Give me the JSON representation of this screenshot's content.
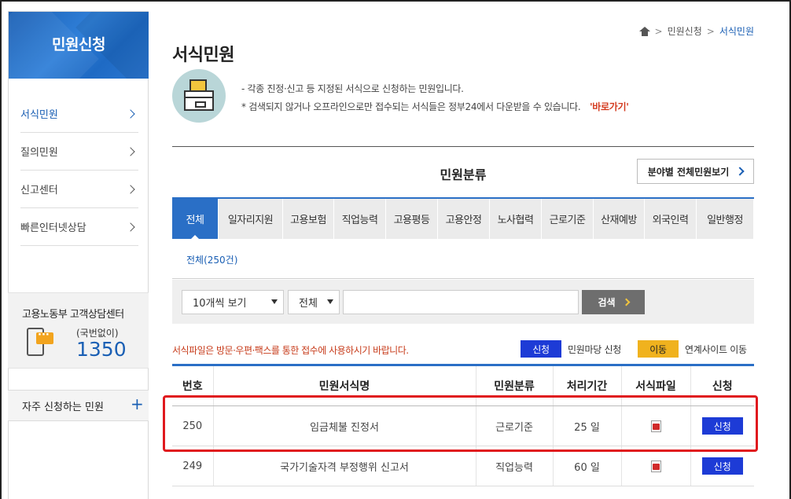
{
  "sidebar": {
    "title": "민원신청",
    "items": [
      {
        "label": "서식민원"
      },
      {
        "label": "질의민원"
      },
      {
        "label": "신고센터"
      },
      {
        "label": "빠른인터넷상담"
      }
    ],
    "callcenter": {
      "title": "고용노동부 고객상담센터",
      "sub": "(국번없이)",
      "number": "1350"
    },
    "frequent": {
      "label": "자주 신청하는 민원",
      "plus": "+"
    }
  },
  "breadcrumb": {
    "items": [
      "민원신청",
      "서식민원"
    ],
    "sep": ">"
  },
  "page_title": "서식민원",
  "notes": {
    "line1": "- 각종 진정·신고 등 지정된 서식으로 신청하는 민원입니다.",
    "line2": "* 검색되지 않거나 오프라인으로만 접수되는 서식들은 정부24에서 다운받을 수 있습니다.",
    "link": "'바로가기'"
  },
  "category": {
    "title": "민원분류",
    "all_button": "분야별 전체민원보기"
  },
  "tabs": [
    "전체",
    "일자리지원",
    "고용보험",
    "직업능력",
    "고용평등",
    "고용안정",
    "노사협력",
    "근로기준",
    "산재예방",
    "외국인력",
    "일반행정"
  ],
  "subtab": "전체(250건)",
  "filter": {
    "per_page": "10개씩 보기",
    "scope": "전체",
    "search_placeholder": "",
    "search_button": "검색"
  },
  "warning": "서식파일은 방문·우편·팩스를 통한 접수에 사용하시기 바랍니다.",
  "legend": [
    {
      "badge": "신청",
      "text": "민원마당 신청",
      "color": "#1d3bd6"
    },
    {
      "badge": "이동",
      "text": "연계사이트 이동",
      "color": "#f0b21e"
    }
  ],
  "table": {
    "headers": [
      "번호",
      "민원서식명",
      "민원분류",
      "처리기간",
      "서식파일",
      "신청"
    ],
    "rows": [
      {
        "no": "250",
        "name": "임금체불 진정서",
        "category": "근로기준",
        "period": "25 일",
        "apply": "신청"
      },
      {
        "no": "249",
        "name": "국가기술자격 부정행위 신고서",
        "category": "직업능력",
        "period": "60 일",
        "apply": "신청"
      }
    ]
  },
  "colors": {
    "accent": "#2a6fc6",
    "apply": "#1d3bd6",
    "highlight": "#e0191e",
    "warn": "#c73b1a"
  }
}
